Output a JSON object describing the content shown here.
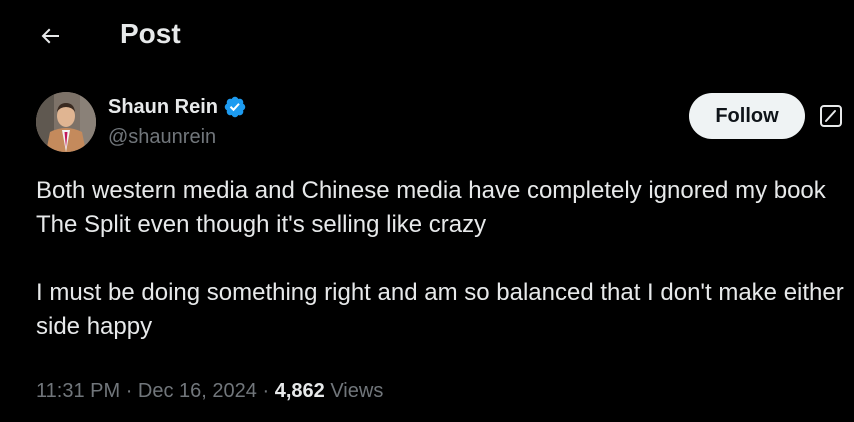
{
  "header": {
    "title": "Post",
    "back_icon": "arrow-left-icon"
  },
  "author": {
    "name": "Shaun Rein",
    "handle": "@shaunrein",
    "verified": true,
    "verified_color": "#1d9bf0"
  },
  "follow_button": {
    "label": "Follow"
  },
  "grok_icon": "grok-icon",
  "tweet": {
    "paragraphs": [
      "Both western media and Chinese media have completely ignored my book The Split even though it's selling like crazy",
      "I must be doing something right and am so balanced that I don't make either side happy"
    ]
  },
  "meta": {
    "time": "11:31 PM",
    "separator": "·",
    "date": "Dec 16, 2024",
    "views_count": "4,862",
    "views_label": "Views"
  },
  "colors": {
    "background": "#000000",
    "text_primary": "#e7e9ea",
    "text_secondary": "#71767b",
    "button_bg": "#eff3f4"
  }
}
